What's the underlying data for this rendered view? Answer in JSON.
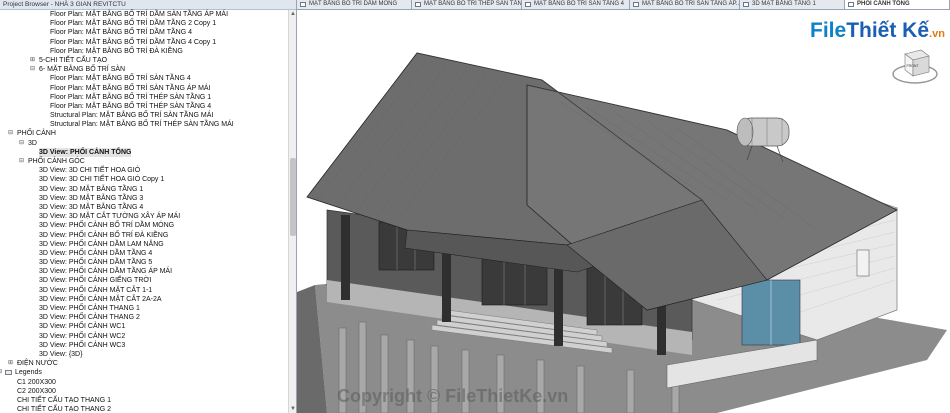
{
  "browser": {
    "title": "Project Browser - NHÀ 3 GIAN REVITCTU",
    "nodes": [
      {
        "label": "Floor Plan: MẶT BẰNG BỐ TRÍ DẦM SÀN TẦNG ÁP MÁI",
        "level": 4,
        "type": "leaf"
      },
      {
        "label": "Floor Plan: MẶT BẰNG BỐ TRÍ DẦM TẦNG 2 Copy 1",
        "level": 4,
        "type": "leaf"
      },
      {
        "label": "Floor Plan: MẶT BẰNG BỐ TRÍ DẦM TẦNG 4",
        "level": 4,
        "type": "leaf"
      },
      {
        "label": "Floor Plan: MẶT BẰNG BỐ TRÍ DẦM TẦNG 4 Copy 1",
        "level": 4,
        "type": "leaf"
      },
      {
        "label": "Floor Plan: MẶT BẰNG BỐ TRÍ ĐÀ KIỀNG",
        "level": 4,
        "type": "leaf"
      },
      {
        "label": "5-CHI TIẾT CẤU TẠO",
        "level": 3,
        "type": "collapsed"
      },
      {
        "label": "6- MẶT BẰNG BỐ TRÍ SÀN",
        "level": 3,
        "type": "expanded"
      },
      {
        "label": "Floor Plan: MẶT BẰNG BỐ TRÍ SÀN TẦNG 4",
        "level": 4,
        "type": "leaf"
      },
      {
        "label": "Floor Plan: MẶT BẰNG BỐ TRÍ SÀN TẦNG ÁP MÁI",
        "level": 4,
        "type": "leaf"
      },
      {
        "label": "Floor Plan: MẶT BẰNG BỐ TRÍ THÉP SÀN TẦNG 1",
        "level": 4,
        "type": "leaf"
      },
      {
        "label": "Floor Plan: MẶT BẰNG BỐ TRÍ THÉP SÀN TẦNG 4",
        "level": 4,
        "type": "leaf"
      },
      {
        "label": "Structural Plan: MẶT BẰNG BỐ TRÍ SÀN TẦNG MÁI",
        "level": 4,
        "type": "leaf"
      },
      {
        "label": "Structural Plan: MẶT BẰNG BỐ TRÍ THÉP SÀN TẦNG MÁI",
        "level": 4,
        "type": "leaf"
      },
      {
        "label": "PHỐI CẢNH",
        "level": 1,
        "type": "expanded"
      },
      {
        "label": "3D",
        "level": 2,
        "type": "expanded"
      },
      {
        "label": "3D View: PHỐI CẢNH TỔNG",
        "level": 3,
        "type": "leaf",
        "selected": true
      },
      {
        "label": "PHỐI CẢNH GÓC",
        "level": 2,
        "type": "expanded"
      },
      {
        "label": "3D View: 3D CHI TIẾT HOA GIÓ",
        "level": 3,
        "type": "leaf"
      },
      {
        "label": "3D View: 3D CHI TIẾT HOA GIÓ Copy 1",
        "level": 3,
        "type": "leaf"
      },
      {
        "label": "3D View: 3D MẶT BẰNG TẦNG 1",
        "level": 3,
        "type": "leaf"
      },
      {
        "label": "3D View: 3D MẶT BẰNG TẦNG 3",
        "level": 3,
        "type": "leaf"
      },
      {
        "label": "3D View: 3D MẶT BẰNG TẦNG 4",
        "level": 3,
        "type": "leaf"
      },
      {
        "label": "3D View: 3D MẶT CẮT TƯỜNG XÂY ÁP MÁI",
        "level": 3,
        "type": "leaf"
      },
      {
        "label": "3D View: PHỐI CẢNH BỐ TRÍ DẦM MÓNG",
        "level": 3,
        "type": "leaf"
      },
      {
        "label": "3D View: PHỐI CẢNH BỐ TRÍ ĐÀ KIỀNG",
        "level": 3,
        "type": "leaf"
      },
      {
        "label": "3D View: PHỐI CẢNH DẦM LAM NĂNG",
        "level": 3,
        "type": "leaf"
      },
      {
        "label": "3D View: PHỐI CẢNH DẦM TẦNG 4",
        "level": 3,
        "type": "leaf"
      },
      {
        "label": "3D View: PHỐI CẢNH DẦM TẦNG 5",
        "level": 3,
        "type": "leaf"
      },
      {
        "label": "3D View: PHỐI CẢNH DẦM TẦNG ÁP MÁI",
        "level": 3,
        "type": "leaf"
      },
      {
        "label": "3D View: PHỐI CẢNH GIẾNG TRỜI",
        "level": 3,
        "type": "leaf"
      },
      {
        "label": "3D View: PHỐI CẢNH MẶT CẮT 1-1",
        "level": 3,
        "type": "leaf"
      },
      {
        "label": "3D View: PHỐI CẢNH MẶT CẮT 2A-2A",
        "level": 3,
        "type": "leaf"
      },
      {
        "label": "3D View: PHỐI CẢNH THANG 1",
        "level": 3,
        "type": "leaf"
      },
      {
        "label": "3D View: PHỐI CẢNH THANG 2",
        "level": 3,
        "type": "leaf"
      },
      {
        "label": "3D View: PHỐI CẢNH WC1",
        "level": 3,
        "type": "leaf"
      },
      {
        "label": "3D View: PHỐI CẢNH WC2",
        "level": 3,
        "type": "leaf"
      },
      {
        "label": "3D View: PHỐI CẢNH WC3",
        "level": 3,
        "type": "leaf"
      },
      {
        "label": "3D View: {3D}",
        "level": 3,
        "type": "leaf"
      },
      {
        "label": "ĐIỆN NƯỚC",
        "level": 1,
        "type": "collapsed"
      },
      {
        "label": "Legends",
        "level": 0,
        "type": "expanded",
        "icon": true
      },
      {
        "label": "C1 200X300",
        "level": 1,
        "type": "leaf"
      },
      {
        "label": "C2 200X300",
        "level": 1,
        "type": "leaf"
      },
      {
        "label": "CHI TIẾT CẤU TẠO THANG 1",
        "level": 1,
        "type": "leaf"
      },
      {
        "label": "CHI TIẾT CẤU TẠO THANG 2",
        "level": 1,
        "type": "leaf"
      }
    ]
  },
  "tabs": [
    {
      "label": "MẶT BẰNG BỐ TRÍ DẦM MÓNG",
      "active": false
    },
    {
      "label": "MẶT BẰNG BỐ TRÍ THÉP SÀN TẦN...",
      "active": false
    },
    {
      "label": "MẶT BẰNG BỐ TRÍ SÀN TẦNG 4",
      "active": false
    },
    {
      "label": "MẶT BẰNG BỐ TRÍ SÀN TẦNG ÁP...",
      "active": false
    },
    {
      "label": "3D MẶT BẰNG TẦNG 1",
      "active": false
    },
    {
      "label": "PHỐI CẢNH TỔNG",
      "active": true
    }
  ],
  "viewport": {
    "watermark": "Copyright © FileThietKe.vn",
    "logo": {
      "main": "File",
      "accent": "Thiết Kế",
      "suffix": ".vn"
    },
    "viewcube_face": "FRONT"
  }
}
